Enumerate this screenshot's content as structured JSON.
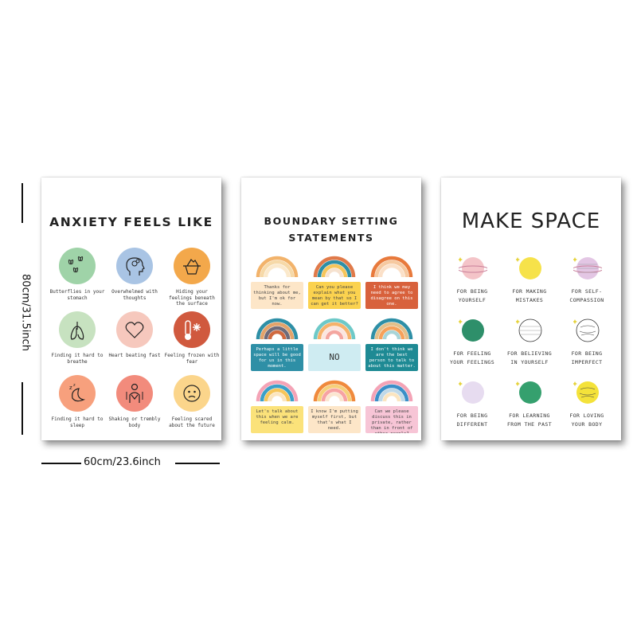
{
  "posters": {
    "anxiety": {
      "title": "ANXIETY FEELS LIKE",
      "items": [
        {
          "label": "Butterflies in your stomach",
          "color": "#9fd3a8",
          "icon": "butterflies-icon"
        },
        {
          "label": "Overwhelmed with thoughts",
          "color": "#a9c4e4",
          "icon": "head-thoughts-icon"
        },
        {
          "label": "Hiding your feelings beneath the surface",
          "color": "#f3a84b",
          "icon": "iceberg-icon"
        },
        {
          "label": "Finding it hard to breathe",
          "color": "#c7e2c0",
          "icon": "lungs-icon"
        },
        {
          "label": "Heart beating fast",
          "color": "#f6c8bd",
          "icon": "heart-icon"
        },
        {
          "label": "Feeling frozen with fear",
          "color": "#d0593e",
          "icon": "thermometer-icon"
        },
        {
          "label": "Finding it hard to sleep",
          "color": "#f7a07d",
          "icon": "moon-sleep-icon"
        },
        {
          "label": "Shaking or trembly body",
          "color": "#f28b7c",
          "icon": "shaking-person-icon"
        },
        {
          "label": "Feeling scared about the future",
          "color": "#fbd58b",
          "icon": "scared-face-icon"
        }
      ]
    },
    "boundary": {
      "title_line1": "BOUNDARY SETTING",
      "title_line2": "STATEMENTS",
      "items": [
        {
          "label": "Thanks for thinking about me, but I'm ok for now.",
          "color": "#fde6c8"
        },
        {
          "label": "Can you please explain what you mean by that so I can get it better?",
          "color": "#fbd24f"
        },
        {
          "label": "I think we may need to agree to disagree on this one.",
          "color": "#d8613c"
        },
        {
          "label": "Perhaps a little space will be good for us in this moment.",
          "color": "#2e8fa6"
        },
        {
          "label": "NO",
          "color": "#cfecf2"
        },
        {
          "label": "I don't think we are the best person to talk to about this matter.",
          "color": "#1e8a94"
        },
        {
          "label": "Let's talk about this when we are feeling calm.",
          "color": "#fbe27a"
        },
        {
          "label": "I know I'm putting myself first, but that's what I need.",
          "color": "#fde6c8"
        },
        {
          "label": "Can we please discuss this in private, rather than in front of other people?",
          "color": "#f7c5d6"
        }
      ]
    },
    "makespace": {
      "title": "MAKE SPACE",
      "items": [
        {
          "label_line1": "FOR BEING",
          "label_line2": "YOURSELF",
          "color": "#f4c4c8",
          "icon": "ringed-planet-icon"
        },
        {
          "label_line1": "FOR MAKING",
          "label_line2": "MISTAKES",
          "color": "#f6e24a",
          "icon": "yellow-planet-icon"
        },
        {
          "label_line1": "FOR SELF-",
          "label_line2": "COMPASSION",
          "color": "#e3c6e4",
          "icon": "striped-planet-icon"
        },
        {
          "label_line1": "FOR FEELING",
          "label_line2": "YOUR FEELINGS",
          "color": "#2e8f6a",
          "icon": "green-planet-icon"
        },
        {
          "label_line1": "FOR BELIEVING",
          "label_line2": "IN YOURSELF",
          "color": "#ffffff",
          "icon": "outline-planet-icon"
        },
        {
          "label_line1": "FOR BEING",
          "label_line2": "IMPERFECT",
          "color": "#ffffff",
          "icon": "swirl-planet-icon"
        },
        {
          "label_line1": "FOR BEING",
          "label_line2": "DIFFERENT",
          "color": "#e7dcf0",
          "icon": "lilac-planet-icon"
        },
        {
          "label_line1": "FOR LEARNING",
          "label_line2": "FROM THE PAST",
          "color": "#35a06e",
          "icon": "teal-planet-icon"
        },
        {
          "label_line1": "FOR LOVING",
          "label_line2": "YOUR BODY",
          "color": "#f4e23a",
          "icon": "yellow-swirl-planet-icon"
        }
      ]
    }
  },
  "dimensions": {
    "height_label": "80cm/31.5inch",
    "width_label": "60cm/23.6inch"
  }
}
